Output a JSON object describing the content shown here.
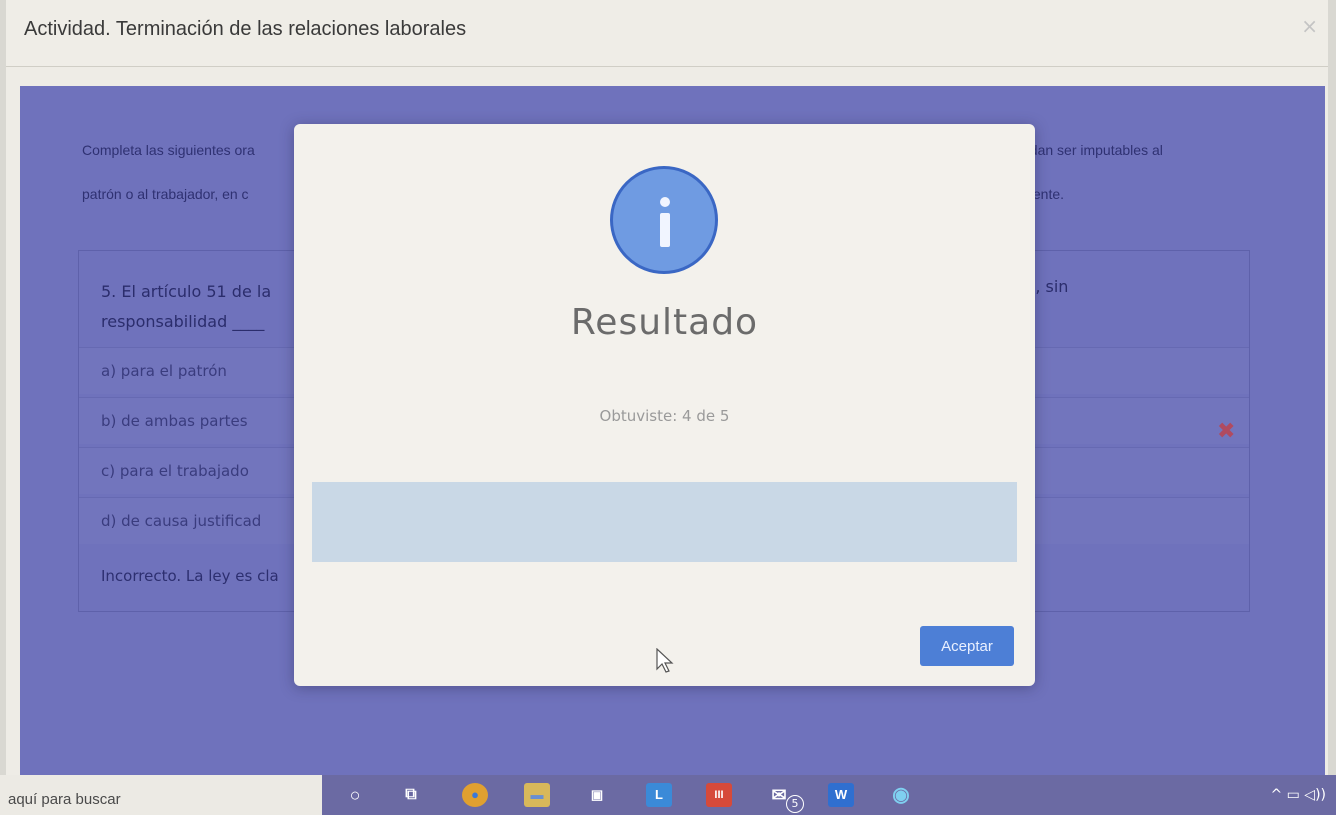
{
  "window": {
    "title": "Actividad. Terminación de las relaciones laborales",
    "close_glyph": "×"
  },
  "background": {
    "instruction_line1": "Completa las siguientes ora",
    "instruction_line1_right": "edan ser imputables al",
    "instruction_line2": "patrón o al trabajador, en c",
    "instruction_line2_right": "diente.",
    "question_text": "5. El artículo 51 de la responsabilidad ____",
    "question_right": "s, sin",
    "options": [
      "a) para el patrón",
      "b) de ambas partes",
      "c) para el trabajado",
      "d) de causa justificad"
    ],
    "feedback": "Incorrecto. La ley es cla",
    "wrong_mark": "✖"
  },
  "modal": {
    "icon": "info-icon",
    "title": "Resultado",
    "score": "Obtuviste: 4 de 5",
    "accept_label": "Aceptar"
  },
  "taskbar": {
    "search_placeholder": "aquí para buscar",
    "icons": [
      {
        "name": "cortana-circle-icon",
        "glyph": "○"
      },
      {
        "name": "task-view-icon",
        "glyph": "⧉"
      },
      {
        "name": "chrome-icon",
        "glyph": "●"
      },
      {
        "name": "file-explorer-icon",
        "glyph": "▬"
      },
      {
        "name": "store-icon",
        "glyph": "▣"
      },
      {
        "name": "app-l-icon",
        "glyph": "L"
      },
      {
        "name": "app-red-icon",
        "glyph": "III"
      },
      {
        "name": "mail-icon",
        "glyph": "✉"
      },
      {
        "name": "word-icon",
        "glyph": "W"
      },
      {
        "name": "edge-icon",
        "glyph": "◉"
      }
    ],
    "mail_badge": "5",
    "tray_text": "^ ▭ ◁))"
  },
  "colors": {
    "backdrop": "#6f72bc",
    "modal_bg": "#f3f1ec",
    "accent": "#4d7fd6",
    "info_icon": "#6f9be2"
  }
}
